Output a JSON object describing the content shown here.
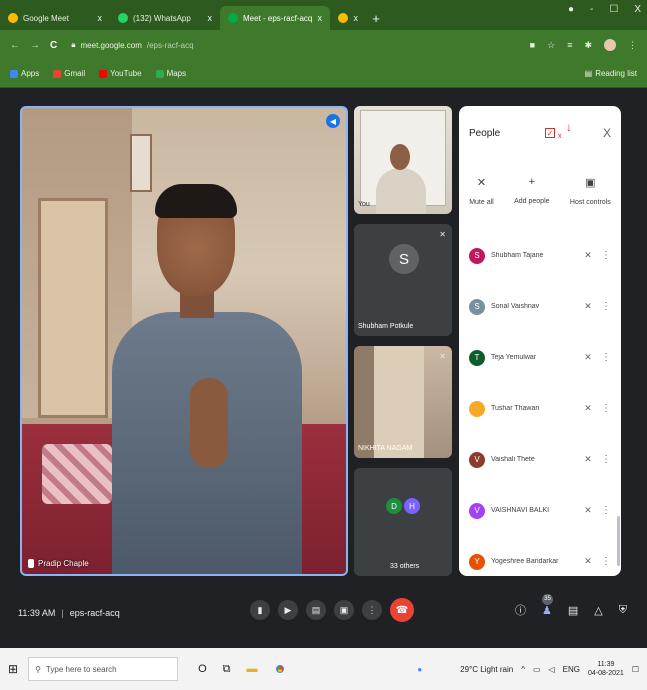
{
  "browser": {
    "tabs": [
      {
        "title": "Google Meet",
        "close": "x",
        "color": "#fbbc05"
      },
      {
        "title": "(132) WhatsApp",
        "close": "x",
        "color": "#25d366"
      },
      {
        "title": "Meet - eps-racf-acq",
        "close": "x",
        "color": "#00ac47"
      },
      {
        "title": "",
        "close": "x",
        "color": "#fbbc05"
      }
    ],
    "new_tab": "+",
    "window_controls": [
      "-",
      "☐",
      "X"
    ],
    "back": "←",
    "forward": "→",
    "reload": "C",
    "url_host": "meet.google.com",
    "url_path": "/eps-racf-acq",
    "bookmarks": [
      {
        "label": "Apps",
        "color": "#4285f4"
      },
      {
        "label": "Gmail",
        "color": "#ea4335"
      },
      {
        "label": "YouTube",
        "color": "#ff0000"
      },
      {
        "label": "Maps",
        "color": "#34a853"
      }
    ],
    "reading_list": "Reading list"
  },
  "meet": {
    "main_tile_name": "Pradip Chaple",
    "self_label": "You",
    "side_tiles": [
      {
        "avatar": "S",
        "name": "Shubham Potkule"
      },
      {
        "name": "NIKHITA NAGAM"
      }
    ],
    "others": {
      "avatars": [
        {
          "letter": "D",
          "color": "#1e8e3e"
        },
        {
          "letter": "H",
          "color": "#7b61ff"
        }
      ],
      "label": "33 others"
    },
    "meeting_time": "11:39 AM",
    "meeting_code": "eps-racf-acq",
    "participant_count": "35"
  },
  "people_panel": {
    "title": "People",
    "close": "X",
    "actions": [
      {
        "label": "Mute all",
        "icon": "mic-off-icon"
      },
      {
        "label": "Add people",
        "icon": "add-person-icon"
      },
      {
        "label": "Host controls",
        "icon": "host-controls-icon"
      }
    ],
    "participants": [
      {
        "initial": "S",
        "name": "Shubham Tajane",
        "color": "#c2185b"
      },
      {
        "initial": "S",
        "name": "Sonal Vaishnav",
        "color": "#78909c"
      },
      {
        "initial": "T",
        "name": "Teja Yemulwar",
        "color": "#0b5e2c"
      },
      {
        "initial": "",
        "name": "Tushar Thawari",
        "color": "#f9a825"
      },
      {
        "initial": "V",
        "name": "Vaishali Thete",
        "color": "#8d3b2f"
      },
      {
        "initial": "V",
        "name": "VAISHNAVI BALKI",
        "color": "#a142f4"
      },
      {
        "initial": "Y",
        "name": "Yogeshree Bandarkar",
        "color": "#e65100"
      }
    ]
  },
  "taskbar": {
    "search_placeholder": "Type here to search",
    "weather": "29°C Light rain",
    "lang": "ENG",
    "time": "11:39",
    "date": "04-08-2021"
  }
}
